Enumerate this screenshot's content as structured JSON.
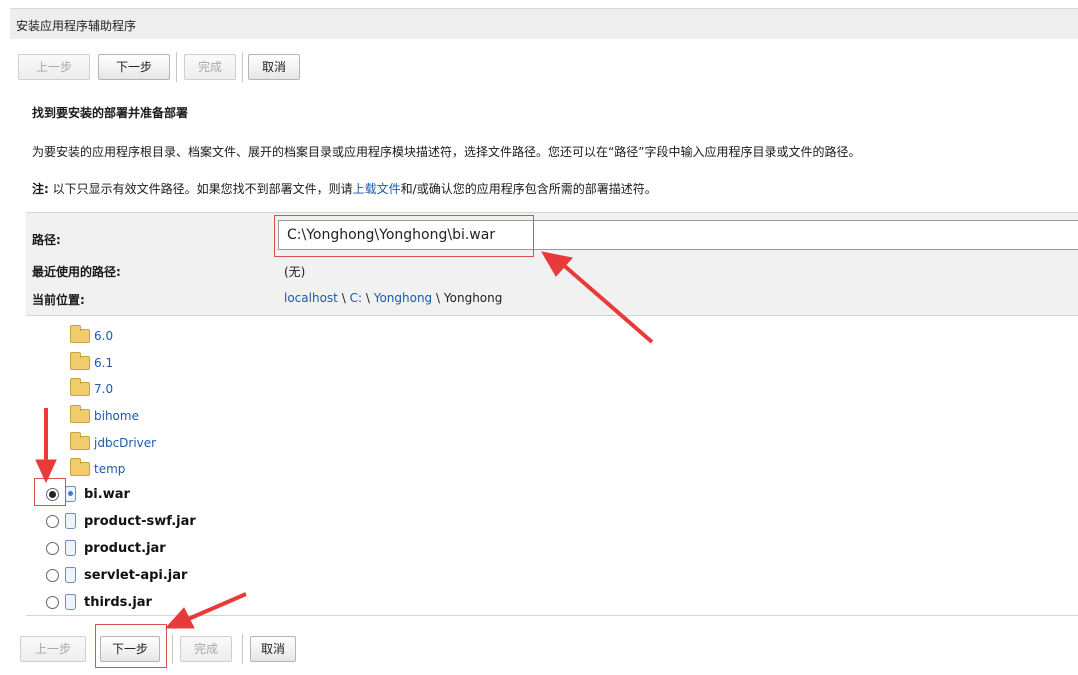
{
  "window": {
    "title": "安装应用程序辅助程序"
  },
  "toolbar": {
    "prev_label": "上一步",
    "next_label": "下一步",
    "finish_label": "完成",
    "cancel_label": "取消"
  },
  "content": {
    "heading": "找到要安装的部署并准备部署",
    "description": "为要安装的应用程序根目录、档案文件、展开的档案目录或应用程序模块描述符，选择文件路径。您还可以在“路径”字段中输入应用程序目录或文件的路径。",
    "note_prefix": "注:",
    "note_text_1": " 以下只显示有效文件路径。如果您找不到部署文件，则请",
    "note_link": "上载文件",
    "note_text_2": "和/或确认您的应用程序包含所需的部署描述符。"
  },
  "form": {
    "path_label": "路径:",
    "path_value": "C:\\Yonghong\\Yonghong\\bi.war",
    "recent_label": "最近使用的路径:",
    "recent_value": "(无)",
    "location_label": "当前位置:",
    "location_host": "localhost",
    "location_sep": "\\",
    "location_drive": "C:",
    "location_dir1": "Yonghong",
    "location_dir2": "Yonghong"
  },
  "tree": {
    "folders": [
      "6.0",
      "6.1",
      "7.0",
      "bihome",
      "jdbcDriver",
      "temp"
    ],
    "files": [
      {
        "name": "bi.war",
        "selected": true
      },
      {
        "name": "product-swf.jar",
        "selected": false
      },
      {
        "name": "product.jar",
        "selected": false
      },
      {
        "name": "servlet-api.jar",
        "selected": false
      },
      {
        "name": "thirds.jar",
        "selected": false
      }
    ]
  },
  "colors": {
    "highlight": "#d9534f",
    "link": "#1d5aa8",
    "form_bg": "#f1f1f1"
  }
}
